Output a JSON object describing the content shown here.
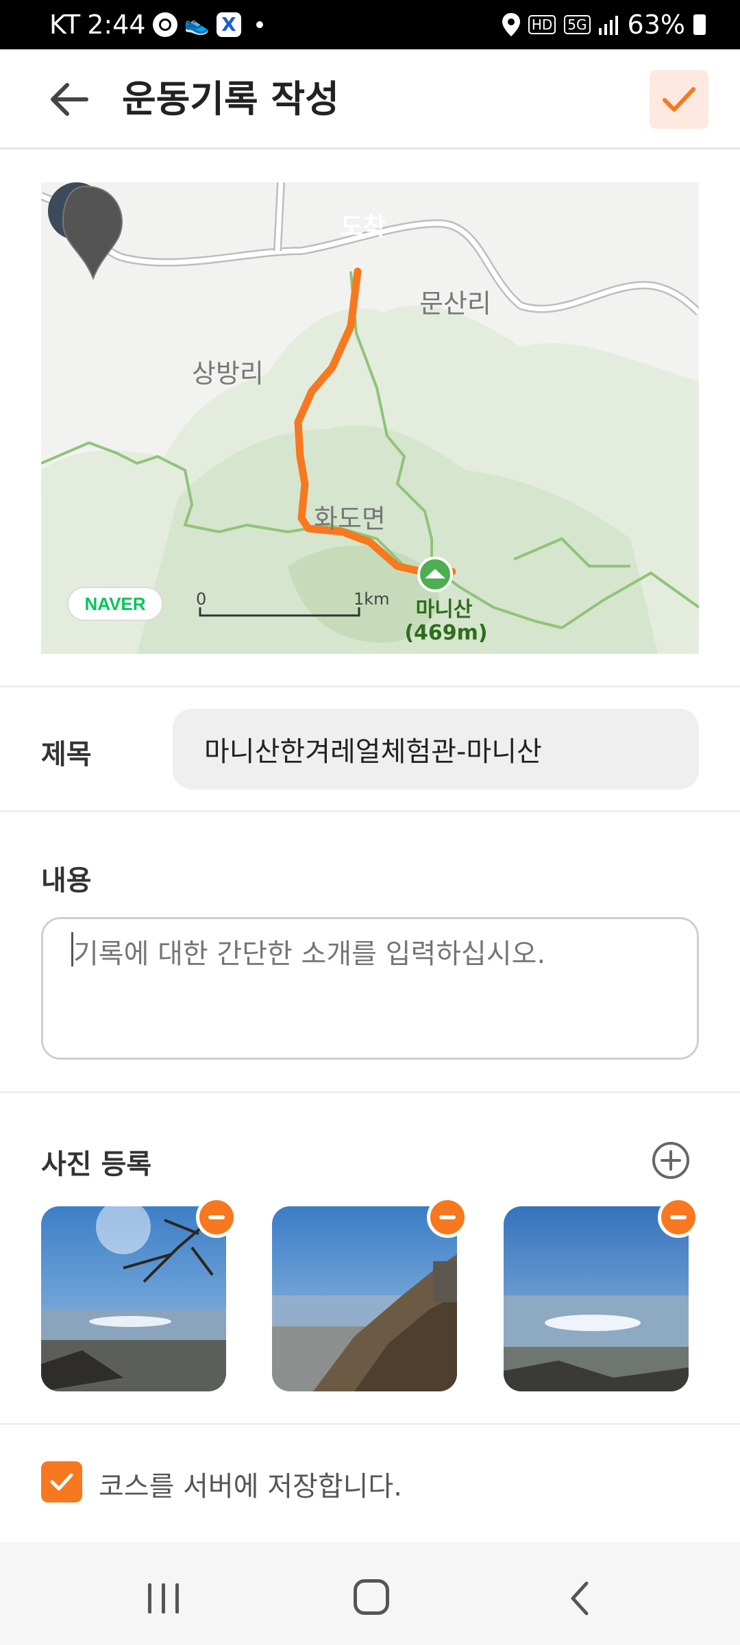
{
  "status_bar": {
    "carrier": "KT",
    "time": "2:44",
    "hd": "HD",
    "network": "5G",
    "battery": "63%"
  },
  "header": {
    "title": "운동기록 작성"
  },
  "map": {
    "places": [
      "문산리",
      "상방리",
      "화도면"
    ],
    "arrival_label": "도착",
    "summit_name": "마니산",
    "summit_elevation": "(469m)",
    "provider": "NAVER",
    "scale_start": "0",
    "scale_end": "1km",
    "route_color": "#f7781f"
  },
  "form": {
    "title_label": "제목",
    "title_value": "마니산한겨레얼체험관-마니산",
    "content_label": "내용",
    "content_placeholder": "기록에 대한 간단한 소개를 입력하십시오.",
    "photos_label": "사진 등록",
    "photo_count": 3,
    "save_course_label": "코스를 서버에 저장합니다.",
    "save_course_checked": true
  },
  "colors": {
    "accent": "#f7781f",
    "accent_light": "#fde9df"
  }
}
